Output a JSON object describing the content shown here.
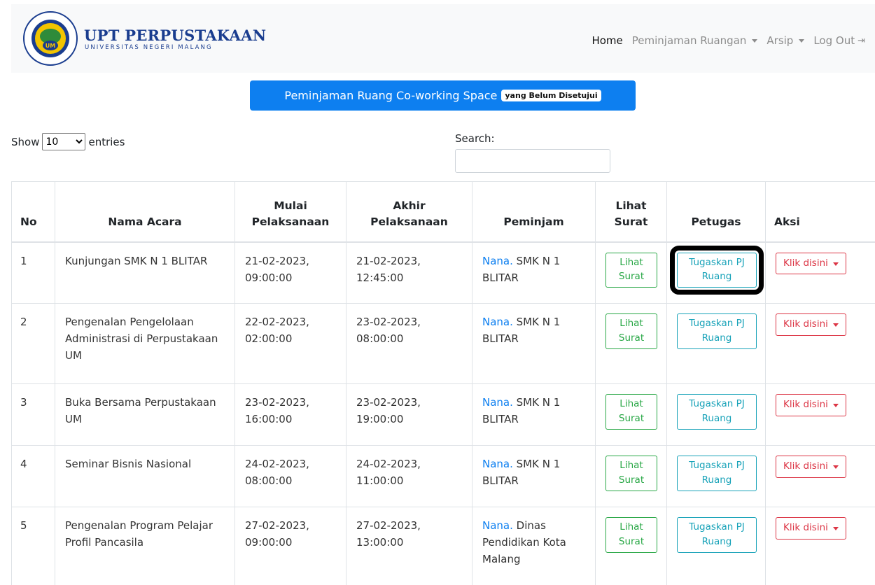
{
  "brand": {
    "title": "UPT PERPUSTAKAAN",
    "subtitle": "UNIVERSITAS NEGERI MALANG",
    "logo_text": "UNIVERSITAS NEGERI MALANG"
  },
  "nav": {
    "home": "Home",
    "peminjaman": "Peminjaman Ruangan",
    "arsip": "Arsip",
    "logout": "Log Out"
  },
  "banner": {
    "text": "Peminjaman Ruang Co-working Space",
    "badge": "yang Belum Disetujui"
  },
  "controls": {
    "show": "Show",
    "entries_value": "10",
    "entries": "entries",
    "search_label": "Search:"
  },
  "table": {
    "headers": {
      "no": "No",
      "nama": "Nama Acara",
      "mulai": "Mulai Pelaksanaan",
      "akhir": "Akhir Pelaksanaan",
      "peminjam": "Peminjam",
      "surat": "Lihat Surat",
      "petugas": "Petugas",
      "aksi": "Aksi"
    },
    "buttons": {
      "surat": "Lihat Surat",
      "tugas": "Tugaskan PJ Ruang",
      "klik": "Klik disini"
    },
    "rows": [
      {
        "no": "1",
        "nama": "Kunjungan SMK N 1 BLITAR",
        "mulai": "21-02-2023, 09:00:00",
        "akhir": "21-02-2023, 12:45:00",
        "pj_name": "Nana.",
        "pj_org": " SMK N 1 BLITAR"
      },
      {
        "no": "2",
        "nama": "Pengenalan Pengelolaan Administrasi di Perpustakaan UM",
        "mulai": "22-02-2023, 02:00:00",
        "akhir": "23-02-2023, 08:00:00",
        "pj_name": "Nana.",
        "pj_org": " SMK N 1 BLITAR"
      },
      {
        "no": "3",
        "nama": "Buka Bersama Perpustakaan UM",
        "mulai": "23-02-2023, 16:00:00",
        "akhir": "23-02-2023, 19:00:00",
        "pj_name": "Nana.",
        "pj_org": " SMK N 1 BLITAR"
      },
      {
        "no": "4",
        "nama": "Seminar Bisnis Nasional",
        "mulai": "24-02-2023, 08:00:00",
        "akhir": "24-02-2023, 11:00:00",
        "pj_name": "Nana.",
        "pj_org": " SMK N 1 BLITAR"
      },
      {
        "no": "5",
        "nama": "Pengenalan Program Pelajar Profil Pancasila",
        "mulai": "27-02-2023, 09:00:00",
        "akhir": "27-02-2023, 13:00:00",
        "pj_name": "Nana.",
        "pj_org": " Dinas Pendidikan Kota Malang"
      }
    ]
  },
  "colors": {
    "primary": "#0d7ff0",
    "success": "#28a745",
    "info": "#17a2b8",
    "danger": "#dc3545",
    "brand": "#1a3d8f"
  }
}
